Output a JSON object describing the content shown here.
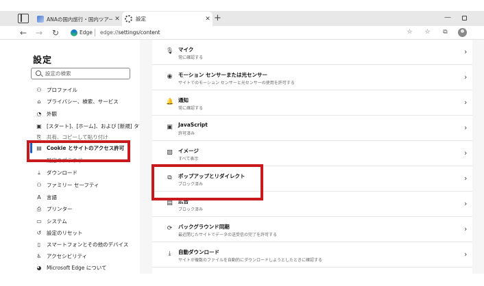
{
  "browser": {
    "tabs": [
      {
        "label": "ANAの国内旅行・国内ツアー | ANA",
        "close": "✕"
      },
      {
        "label": "設定",
        "close": "✕"
      }
    ],
    "new_tab": "+",
    "window_min": "—",
    "nav": {
      "back": "←",
      "forward": "→",
      "reload": "↻"
    },
    "edge_label": "Edge",
    "url_prefix": "edge://",
    "url_path": "settings/content"
  },
  "sidebar": {
    "title": "設定",
    "search_placeholder": "設定の検索",
    "items": [
      {
        "label": "プロファイル",
        "icon": "person-icon"
      },
      {
        "label": "プライバシー、検索、サービス",
        "icon": "lock-icon"
      },
      {
        "label": "外観",
        "icon": "appearance-icon"
      },
      {
        "label": "[スタート]、[ホーム]、および [新規] タブ",
        "icon": "home-icon"
      },
      {
        "label": "共有、コピーして貼り付け",
        "icon": "share-icon"
      },
      {
        "label": "Cookie とサイトのアクセス許可",
        "icon": "cookie-icon"
      },
      {
        "label": "既定のブラウザー",
        "icon": "browser-icon"
      },
      {
        "label": "ダウンロード",
        "icon": "download-icon"
      },
      {
        "label": "ファミリー セーフティ",
        "icon": "family-icon"
      },
      {
        "label": "言語",
        "icon": "language-icon"
      },
      {
        "label": "プリンター",
        "icon": "printer-icon"
      },
      {
        "label": "システム",
        "icon": "system-icon"
      },
      {
        "label": "設定のリセット",
        "icon": "reset-icon"
      },
      {
        "label": "スマートフォンとその他のデバイス",
        "icon": "phone-icon"
      },
      {
        "label": "アクセシビリティ",
        "icon": "accessibility-icon"
      },
      {
        "label": "Microsoft Edge について",
        "icon": "edge-icon"
      }
    ]
  },
  "content": {
    "rows": [
      {
        "title": "マイク",
        "subtitle": "常に確認する",
        "icon": "microphone-icon"
      },
      {
        "title": "モーション センサーまたは光センサー",
        "subtitle": "サイトでのモーション センサーと光センサーの使用を許可する",
        "icon": "sensor-icon"
      },
      {
        "title": "通知",
        "subtitle": "常に確認する",
        "icon": "bell-icon"
      },
      {
        "title": "JavaScript",
        "subtitle": "許可済み",
        "icon": "javascript-icon"
      },
      {
        "title": "イメージ",
        "subtitle": "すべて表示",
        "icon": "image-icon"
      },
      {
        "title": "ポップアップとリダイレクト",
        "subtitle": "ブロック済み",
        "icon": "popup-icon"
      },
      {
        "title": "広告",
        "subtitle": "ブロック済み",
        "icon": "ads-icon"
      },
      {
        "title": "バックグラウンド同期",
        "subtitle": "最近閉じたサイトでデータの送受信の完了を許可する",
        "icon": "sync-icon"
      },
      {
        "title": "自動ダウンロード",
        "subtitle": "サイトが複数のファイルを自動的にダウンロードしようとしたときに確認する",
        "icon": "download-icon"
      }
    ],
    "chevron": "›"
  },
  "colors": {
    "highlight": "#c8191c",
    "selection_bar": "#1a5cc7"
  }
}
